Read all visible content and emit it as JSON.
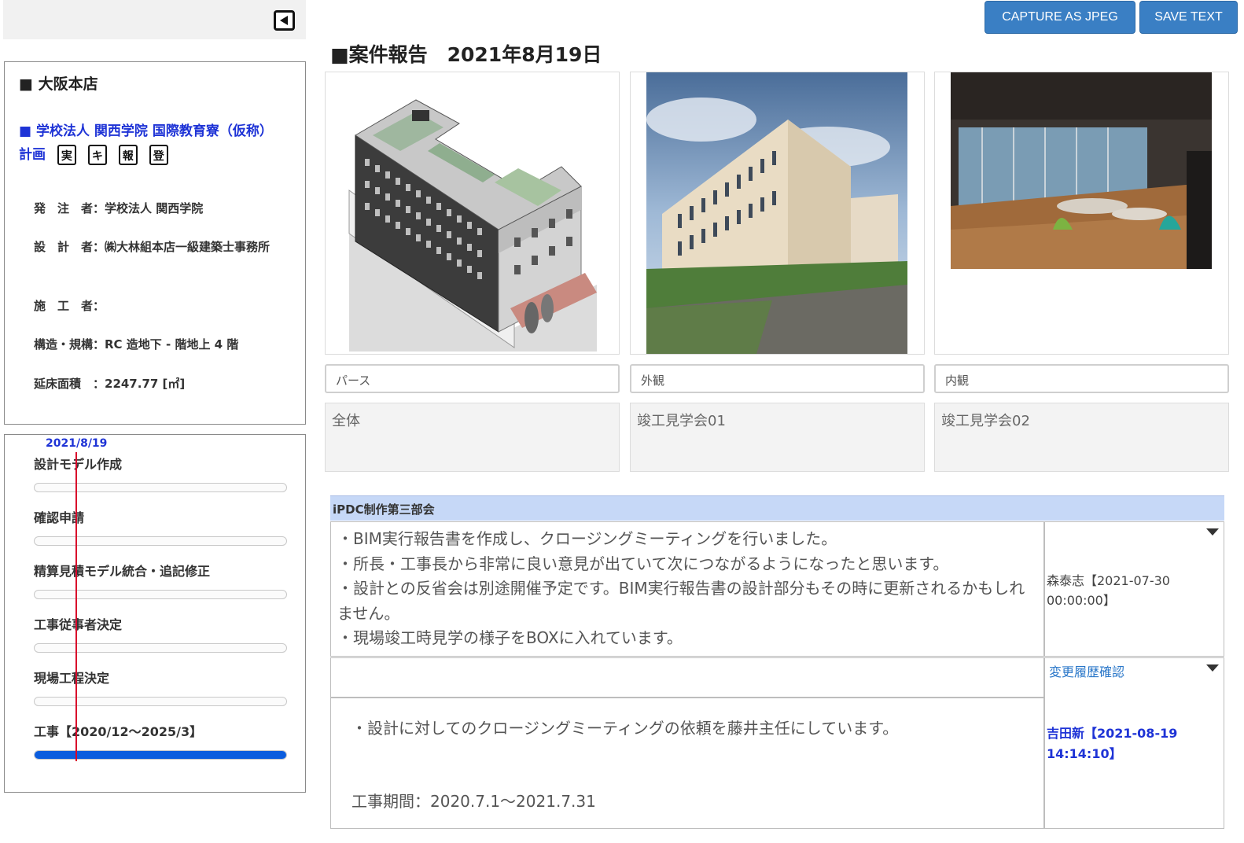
{
  "left_panel": {
    "collapse_icon": "collapse-left-icon",
    "office": "■ 大阪本店",
    "project": {
      "title": "■ 学校法人 関西学院 国際教育寮（仮称）計画",
      "badges": [
        "実",
        "キ",
        "報",
        "登"
      ]
    },
    "info": {
      "client": "発　注　者：学校法人 関西学院",
      "designer": "設　計　者：㈱大林組本店一級建築士事務所",
      "contractor": "施　工　者：",
      "structure": "構造・規構：RC 造地下 - 階地上 4 階",
      "floor_area": "延床面積　：2247.77 [㎡]"
    }
  },
  "progress": {
    "today": "2021/8/19",
    "tasks": [
      {
        "label": "設計モデル作成",
        "progress": 0
      },
      {
        "label": "確認申請",
        "progress": 0
      },
      {
        "label": "精算見積モデル統合・追記修正",
        "progress": 0
      },
      {
        "label": "工事従事者決定",
        "progress": 0
      },
      {
        "label": "現場工程決定",
        "progress": 0
      },
      {
        "label": "工事【2020/12～2025/3】",
        "progress": 1
      }
    ]
  },
  "toolbar": {
    "capture_label": "CAPTURE AS JPEG",
    "save_label": "SAVE TEXT"
  },
  "report": {
    "title": "■案件報告　2021年8月19日",
    "photos": [
      {
        "caption": "パース",
        "description": "全体"
      },
      {
        "caption": "外観",
        "description": "竣工見学会01"
      },
      {
        "caption": "内観",
        "description": "竣工見学会02"
      }
    ],
    "department": "iPDC制作第三部会",
    "entries": [
      {
        "lines": [
          "・BIM実行報告書を作成し、クロージングミーティングを行いました。",
          "・所長・工事長から非常に良い意見が出ていて次につながるようになったと思います。",
          "・設計との反省会は別途開催予定です。BIM実行報告書の設計部分もその時に更新されるかもしれません。",
          "・現場竣工時見学の様子をBOXに入れています。"
        ],
        "author": "森泰志【2021-07-30 00:00:00】"
      },
      {
        "line1": "・設計に対してのクロージングミーティングの依頼を藤井主任にしています。",
        "line2": "工事期間：2020.7.1～2021.7.31",
        "history_link": "変更履歴確認",
        "author": "吉田新【2021-08-19 14:14:10】"
      }
    ]
  },
  "colors": {
    "button_blue": "#3a7fc4",
    "link_blue": "#1e33d6",
    "progress_fill": "#0b5dde",
    "today_line": "#d9002a",
    "header_band": "#c6d8f7"
  }
}
